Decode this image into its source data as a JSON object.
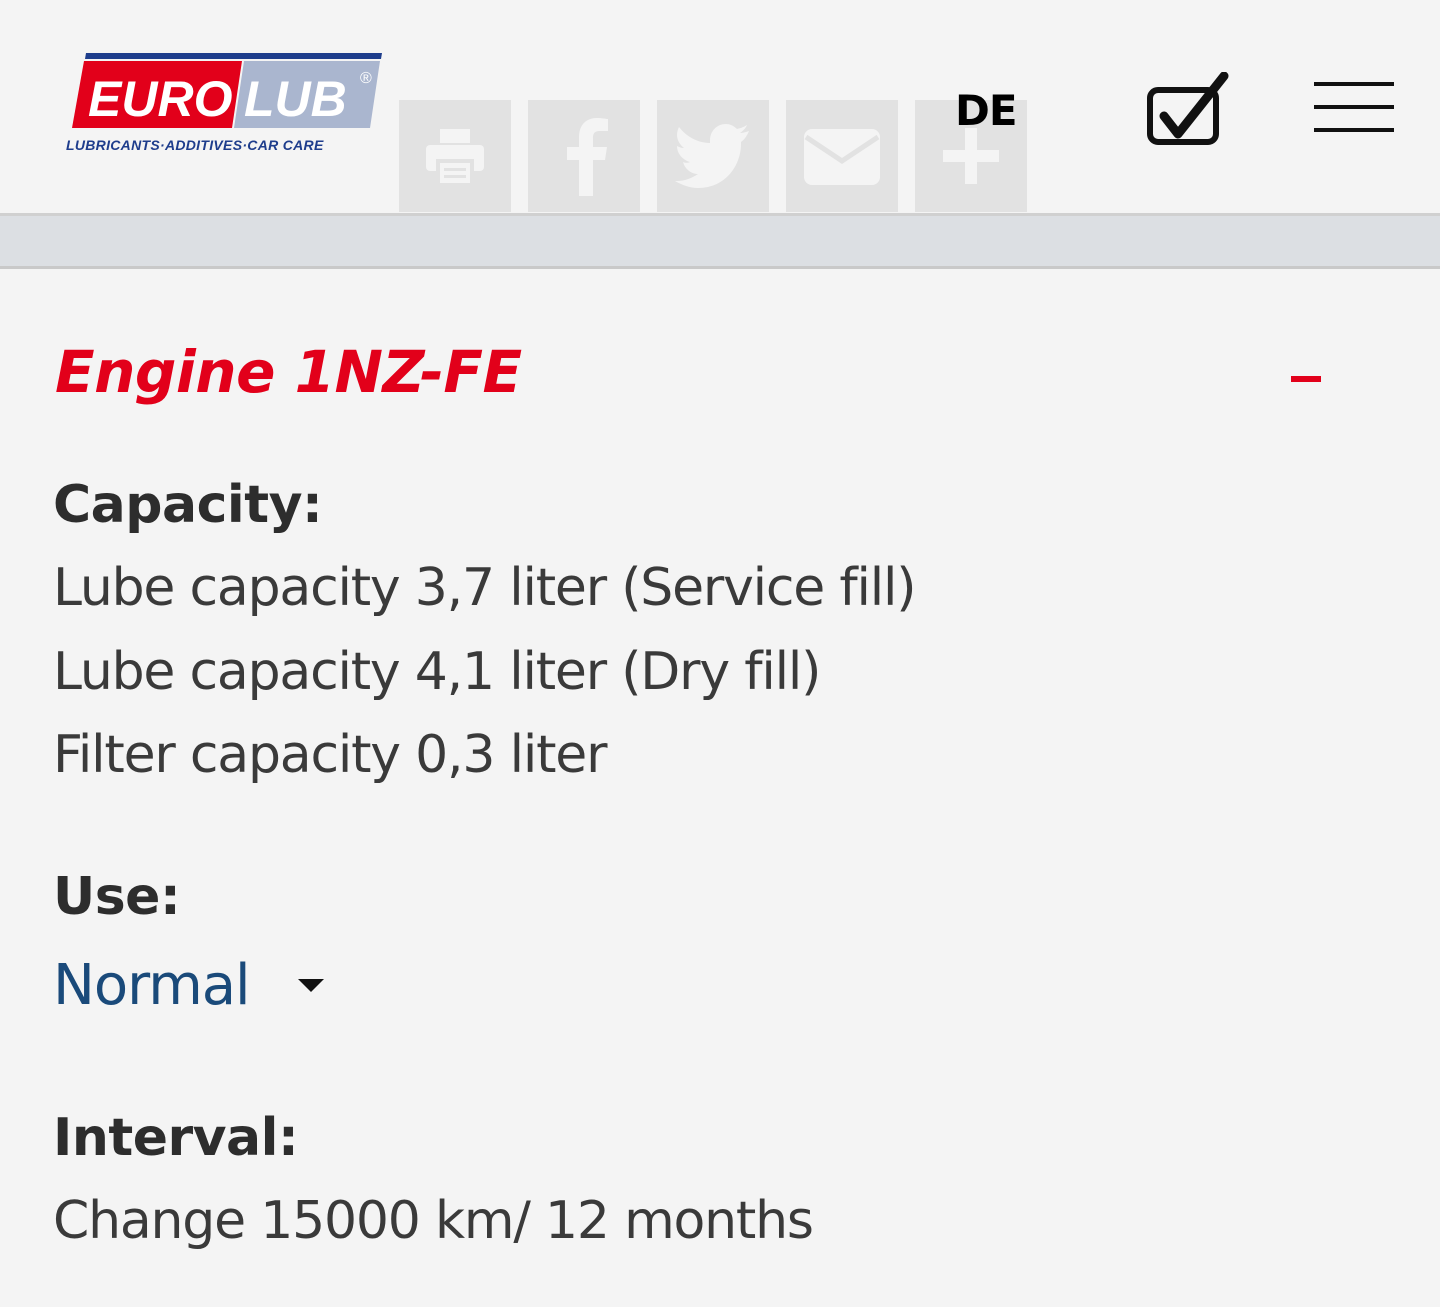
{
  "header": {
    "logo": {
      "brand_part1": "EURO",
      "brand_part2": "LUB",
      "registered": "®",
      "tagline": "LUBRICANTS·ADDITIVES·CAR CARE"
    },
    "share_buttons": [
      {
        "icon": "print-icon"
      },
      {
        "icon": "facebook-icon"
      },
      {
        "icon": "twitter-icon"
      },
      {
        "icon": "mail-icon"
      },
      {
        "icon": "plus-icon"
      }
    ],
    "language": "DE",
    "checklist_icon": "checkbox-check-icon",
    "menu_icon": "hamburger-menu-icon"
  },
  "main": {
    "engine_title": "Engine 1NZ-FE",
    "capacity_label": "Capacity:",
    "capacity_lines": [
      "Lube capacity 3,7 liter (Service fill)",
      "Lube capacity 4,1 liter (Dry fill)",
      "Filter capacity 0,3 liter"
    ],
    "use_label": "Use:",
    "use_value": "Normal",
    "interval_label": "Interval:",
    "interval_value": "Change 15000 km/ 12 months"
  },
  "colors": {
    "accent_red": "#e2001a",
    "brand_blue": "#1e3d8c",
    "link_blue": "#1a4a7a",
    "background": "#f4f4f4"
  }
}
